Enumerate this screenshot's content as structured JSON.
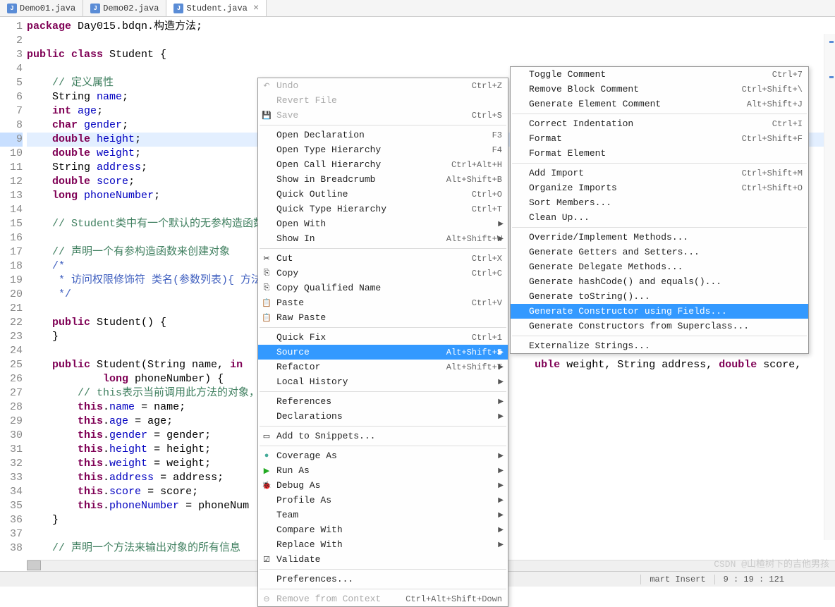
{
  "tabs": [
    {
      "label": "Demo01.java",
      "active": false
    },
    {
      "label": "Demo02.java",
      "active": false
    },
    {
      "label": "Student.java",
      "active": true
    }
  ],
  "gutter_lines": [
    "1",
    "2",
    "3",
    "4",
    "5",
    "6",
    "7",
    "8",
    "9",
    "10",
    "11",
    "12",
    "13",
    "14",
    "15",
    "16",
    "17",
    "18",
    "19",
    "20",
    "21",
    "22",
    "23",
    "24",
    "25",
    "26",
    "27",
    "28",
    "29",
    "30",
    "31",
    "32",
    "33",
    "34",
    "35",
    "36",
    "37",
    "38"
  ],
  "highlighted_line": 9,
  "code_lines": [
    {
      "t": "package",
      "r": " Day015.bdqn.构造方法;",
      "kw": true
    },
    {
      "t": "",
      "r": ""
    },
    {
      "parts": [
        {
          "k": "public",
          "kw": 1
        },
        {
          "k": " "
        },
        {
          "k": "class",
          "kw": 1
        },
        {
          "k": " Student {"
        }
      ]
    },
    {
      "t": "",
      "r": ""
    },
    {
      "t": "    ",
      "cm": "// 定义属性"
    },
    {
      "parts": [
        {
          "k": "    String "
        },
        {
          "k": "name",
          "f": 1
        },
        {
          "k": ";"
        }
      ]
    },
    {
      "parts": [
        {
          "k": "    "
        },
        {
          "k": "int",
          "kw": 1
        },
        {
          "k": " "
        },
        {
          "k": "age",
          "f": 1
        },
        {
          "k": ";"
        }
      ]
    },
    {
      "parts": [
        {
          "k": "    "
        },
        {
          "k": "char",
          "kw": 1
        },
        {
          "k": " "
        },
        {
          "k": "gender",
          "f": 1
        },
        {
          "k": ";"
        }
      ]
    },
    {
      "parts": [
        {
          "k": "    "
        },
        {
          "k": "double",
          "kw": 1
        },
        {
          "k": " "
        },
        {
          "k": "height",
          "f": 1
        },
        {
          "k": ";"
        }
      ],
      "hl": true
    },
    {
      "parts": [
        {
          "k": "    "
        },
        {
          "k": "double",
          "kw": 1
        },
        {
          "k": " "
        },
        {
          "k": "weight",
          "f": 1
        },
        {
          "k": ";"
        }
      ]
    },
    {
      "parts": [
        {
          "k": "    String "
        },
        {
          "k": "address",
          "f": 1
        },
        {
          "k": ";"
        }
      ]
    },
    {
      "parts": [
        {
          "k": "    "
        },
        {
          "k": "double",
          "kw": 1
        },
        {
          "k": " "
        },
        {
          "k": "score",
          "f": 1
        },
        {
          "k": ";"
        }
      ]
    },
    {
      "parts": [
        {
          "k": "    "
        },
        {
          "k": "long",
          "kw": 1
        },
        {
          "k": " "
        },
        {
          "k": "phoneNumber",
          "f": 1
        },
        {
          "k": ";"
        }
      ]
    },
    {
      "t": "",
      "r": ""
    },
    {
      "t": "    ",
      "cm": "// Student类中有一个默认的无参构造函数，"
    },
    {
      "t": "",
      "r": ""
    },
    {
      "t": "    ",
      "cm": "// 声明一个有参构造函数来创建对象"
    },
    {
      "t": "    ",
      "cmj": "/*"
    },
    {
      "t": "    ",
      "cmj": " * 访问权限修饰符 类名(参数列表){ 方法体"
    },
    {
      "t": "    ",
      "cmj": " */"
    },
    {
      "t": "",
      "r": ""
    },
    {
      "parts": [
        {
          "k": "    "
        },
        {
          "k": "public",
          "kw": 1
        },
        {
          "k": " Student() {"
        }
      ]
    },
    {
      "t": "    }",
      "r": ""
    },
    {
      "t": "",
      "r": ""
    },
    {
      "parts": [
        {
          "k": "    "
        },
        {
          "k": "public",
          "kw": 1
        },
        {
          "k": " Student(String name, "
        },
        {
          "k": "in",
          "kw": 1
        },
        {
          "k": "                                              "
        },
        {
          "k": "uble",
          "kw": 1
        },
        {
          "k": " weight, String address, "
        },
        {
          "k": "double",
          "kw": 1
        },
        {
          "k": " score,"
        }
      ]
    },
    {
      "parts": [
        {
          "k": "            "
        },
        {
          "k": "long",
          "kw": 1
        },
        {
          "k": " phoneNumber) {"
        }
      ]
    },
    {
      "t": "        ",
      "cm": "// this表示当前调用此方法的对象，谁"
    },
    {
      "parts": [
        {
          "k": "        "
        },
        {
          "k": "this",
          "kw": 1
        },
        {
          "k": "."
        },
        {
          "k": "name",
          "f": 1
        },
        {
          "k": " = name;"
        }
      ]
    },
    {
      "parts": [
        {
          "k": "        "
        },
        {
          "k": "this",
          "kw": 1
        },
        {
          "k": "."
        },
        {
          "k": "age",
          "f": 1
        },
        {
          "k": " = age;"
        }
      ]
    },
    {
      "parts": [
        {
          "k": "        "
        },
        {
          "k": "this",
          "kw": 1
        },
        {
          "k": "."
        },
        {
          "k": "gender",
          "f": 1
        },
        {
          "k": " = gender;"
        }
      ]
    },
    {
      "parts": [
        {
          "k": "        "
        },
        {
          "k": "this",
          "kw": 1
        },
        {
          "k": "."
        },
        {
          "k": "height",
          "f": 1
        },
        {
          "k": " = height;"
        }
      ]
    },
    {
      "parts": [
        {
          "k": "        "
        },
        {
          "k": "this",
          "kw": 1
        },
        {
          "k": "."
        },
        {
          "k": "weight",
          "f": 1
        },
        {
          "k": " = weight;"
        }
      ]
    },
    {
      "parts": [
        {
          "k": "        "
        },
        {
          "k": "this",
          "kw": 1
        },
        {
          "k": "."
        },
        {
          "k": "address",
          "f": 1
        },
        {
          "k": " = address;"
        }
      ]
    },
    {
      "parts": [
        {
          "k": "        "
        },
        {
          "k": "this",
          "kw": 1
        },
        {
          "k": "."
        },
        {
          "k": "score",
          "f": 1
        },
        {
          "k": " = score;"
        }
      ]
    },
    {
      "parts": [
        {
          "k": "        "
        },
        {
          "k": "this",
          "kw": 1
        },
        {
          "k": "."
        },
        {
          "k": "phoneNumber",
          "f": 1
        },
        {
          "k": " = phoneNum"
        }
      ]
    },
    {
      "t": "    }",
      "r": ""
    },
    {
      "t": "",
      "r": ""
    },
    {
      "t": "    ",
      "cm": "// 声明一个方法来输出对象的所有信息"
    }
  ],
  "context_menu": [
    {
      "label": "Undo",
      "shortcut": "Ctrl+Z",
      "dis": true,
      "icon": "↶"
    },
    {
      "label": "Revert File",
      "dis": true
    },
    {
      "label": "Save",
      "shortcut": "Ctrl+S",
      "dis": true,
      "icon": "💾"
    },
    {
      "sep": true
    },
    {
      "label": "Open Declaration",
      "shortcut": "F3"
    },
    {
      "label": "Open Type Hierarchy",
      "shortcut": "F4"
    },
    {
      "label": "Open Call Hierarchy",
      "shortcut": "Ctrl+Alt+H"
    },
    {
      "label": "Show in Breadcrumb",
      "shortcut": "Alt+Shift+B"
    },
    {
      "label": "Quick Outline",
      "shortcut": "Ctrl+O"
    },
    {
      "label": "Quick Type Hierarchy",
      "shortcut": "Ctrl+T"
    },
    {
      "label": "Open With",
      "sub": true
    },
    {
      "label": "Show In",
      "shortcut": "Alt+Shift+W",
      "sub": true
    },
    {
      "sep": true
    },
    {
      "label": "Cut",
      "shortcut": "Ctrl+X",
      "icon": "✂"
    },
    {
      "label": "Copy",
      "shortcut": "Ctrl+C",
      "icon": "⎘"
    },
    {
      "label": "Copy Qualified Name",
      "icon": "⎘"
    },
    {
      "label": "Paste",
      "shortcut": "Ctrl+V",
      "icon": "📋"
    },
    {
      "label": "Raw Paste",
      "icon": "📋"
    },
    {
      "sep": true
    },
    {
      "label": "Quick Fix",
      "shortcut": "Ctrl+1"
    },
    {
      "label": "Source",
      "shortcut": "Alt+Shift+S",
      "sub": true,
      "sel": true
    },
    {
      "label": "Refactor",
      "shortcut": "Alt+Shift+T",
      "sub": true
    },
    {
      "label": "Local History",
      "sub": true
    },
    {
      "sep": true
    },
    {
      "label": "References",
      "sub": true
    },
    {
      "label": "Declarations",
      "sub": true
    },
    {
      "sep": true
    },
    {
      "label": "Add to Snippets...",
      "icon": "▭"
    },
    {
      "sep": true
    },
    {
      "label": "Coverage As",
      "sub": true,
      "icon": "●",
      "ic": "#4a9"
    },
    {
      "label": "Run As",
      "sub": true,
      "icon": "▶",
      "ic": "#2a2"
    },
    {
      "label": "Debug As",
      "sub": true,
      "icon": "🐞",
      "ic": "#3a8"
    },
    {
      "label": "Profile As",
      "sub": true
    },
    {
      "label": "Team",
      "sub": true
    },
    {
      "label": "Compare With",
      "sub": true
    },
    {
      "label": "Replace With",
      "sub": true
    },
    {
      "label": "Validate",
      "icon": "☑"
    },
    {
      "sep": true
    },
    {
      "label": "Preferences..."
    },
    {
      "sep": true
    },
    {
      "label": "Remove from Context",
      "shortcut": "Ctrl+Alt+Shift+Down",
      "dis": true,
      "icon": "⊖"
    }
  ],
  "submenu": [
    {
      "label": "Toggle Comment",
      "shortcut": "Ctrl+7"
    },
    {
      "label": "Remove Block Comment",
      "shortcut": "Ctrl+Shift+\\"
    },
    {
      "label": "Generate Element Comment",
      "shortcut": "Alt+Shift+J"
    },
    {
      "sep": true
    },
    {
      "label": "Correct Indentation",
      "shortcut": "Ctrl+I"
    },
    {
      "label": "Format",
      "shortcut": "Ctrl+Shift+F"
    },
    {
      "label": "Format Element"
    },
    {
      "sep": true
    },
    {
      "label": "Add Import",
      "shortcut": "Ctrl+Shift+M"
    },
    {
      "label": "Organize Imports",
      "shortcut": "Ctrl+Shift+O"
    },
    {
      "label": "Sort Members..."
    },
    {
      "label": "Clean Up..."
    },
    {
      "sep": true
    },
    {
      "label": "Override/Implement Methods..."
    },
    {
      "label": "Generate Getters and Setters..."
    },
    {
      "label": "Generate Delegate Methods..."
    },
    {
      "label": "Generate hashCode() and equals()..."
    },
    {
      "label": "Generate toString()..."
    },
    {
      "label": "Generate Constructor using Fields...",
      "sel": true
    },
    {
      "label": "Generate Constructors from Superclass..."
    },
    {
      "sep": true
    },
    {
      "label": "Externalize Strings..."
    }
  ],
  "status": {
    "insert": "mart Insert",
    "pos": "9 : 19 : 121",
    "extra": ""
  },
  "watermark": "CSDN @山楂树下的吉他男孩"
}
